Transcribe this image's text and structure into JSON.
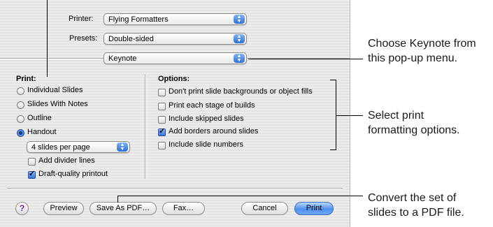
{
  "printer": {
    "label": "Printer:",
    "value": "Flying Formatters"
  },
  "presets": {
    "label": "Presets:",
    "value": "Double-sided"
  },
  "panel": {
    "value": "Keynote"
  },
  "print_section": {
    "heading": "Print:",
    "options": [
      {
        "label": "Individual Slides",
        "selected": false
      },
      {
        "label": "Slides With Notes",
        "selected": false
      },
      {
        "label": "Outline",
        "selected": false
      },
      {
        "label": "Handout",
        "selected": true
      }
    ],
    "slides_per_page": "4 slides per page",
    "add_divider_lines": {
      "label": "Add divider lines",
      "checked": false
    },
    "draft_quality": {
      "label": "Draft-quality printout",
      "checked": true
    }
  },
  "options_section": {
    "heading": "Options:",
    "items": [
      {
        "label": "Don't print slide backgrounds or object fills",
        "checked": false
      },
      {
        "label": "Print each stage of builds",
        "checked": false
      },
      {
        "label": "Include skipped slides",
        "checked": false
      },
      {
        "label": "Add borders around slides",
        "checked": true
      },
      {
        "label": "Include slide numbers",
        "checked": false
      }
    ]
  },
  "buttons": {
    "help": "?",
    "preview": "Preview",
    "save_as_pdf": "Save As PDF…",
    "fax": "Fax…",
    "cancel": "Cancel",
    "print": "Print"
  },
  "callouts": {
    "popup_line1": "Choose Keynote from",
    "popup_line2": "this pop-up menu.",
    "options_line1": "Select print",
    "options_line2": "formatting options.",
    "pdf_line1": "Convert the set of",
    "pdf_line2": "slides to a PDF file."
  }
}
